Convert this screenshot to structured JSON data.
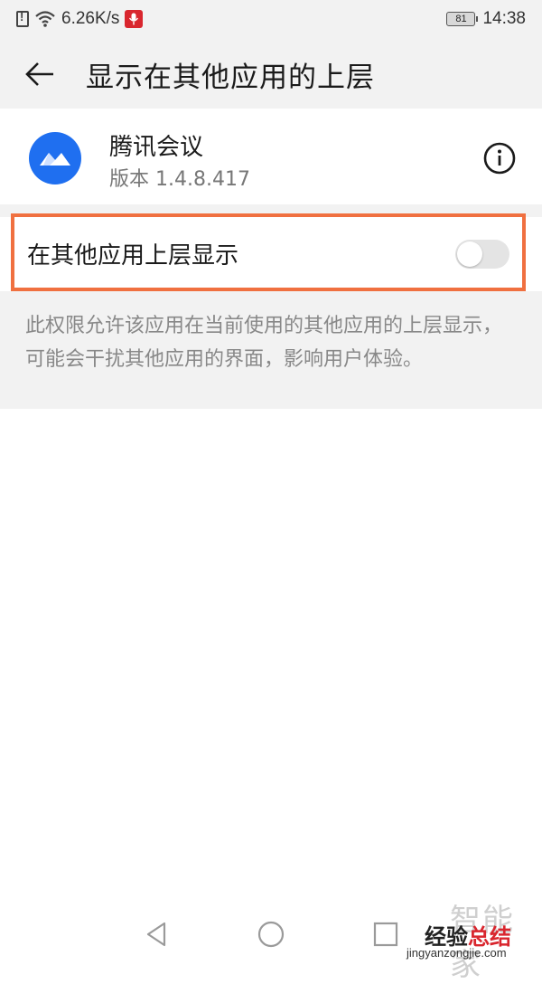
{
  "status_bar": {
    "network_speed": "6.26K/s",
    "battery_level": "81",
    "time": "14:38",
    "icons": [
      "sim-alert-icon",
      "wifi-icon",
      "mic-recording-icon",
      "battery-icon"
    ],
    "mic_badge_color": "#d9262e"
  },
  "header": {
    "back_icon": "arrow-left-icon",
    "title": "显示在其他应用的上层"
  },
  "app": {
    "name": "腾讯会议",
    "version": "版本 1.4.8.417",
    "icon": "tencent-meeting-logo",
    "icon_color": "#1f6ff0",
    "info_icon": "info-icon"
  },
  "permission": {
    "label": "在其他应用上层显示",
    "enabled": false,
    "highlight_color": "#f07040",
    "description": "此权限允许该应用在当前使用的其他应用的上层显示，可能会干扰其他应用的界面，影响用户体验。"
  },
  "nav": {
    "back_icon": "triangle-back-icon",
    "home_icon": "circle-home-icon",
    "recents_icon": "square-recents-icon"
  },
  "watermark": {
    "top": "智能家",
    "brand_a": "经验",
    "brand_b": "总结",
    "url": "jingyanzongjie.com"
  }
}
